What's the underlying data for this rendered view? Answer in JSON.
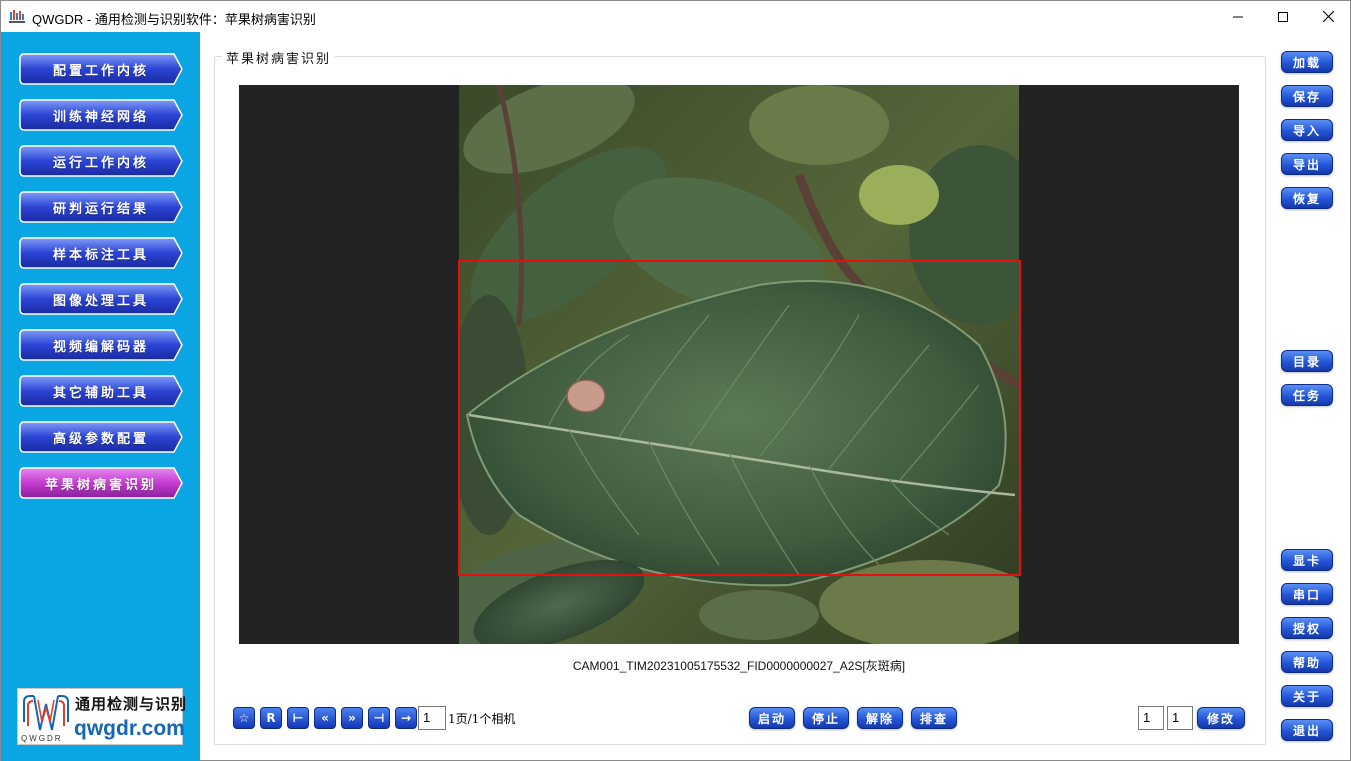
{
  "window": {
    "title": "QWGDR - 通用检测与识别软件：苹果树病害识别",
    "controls": [
      "minimize",
      "maximize",
      "close"
    ]
  },
  "sidebar": {
    "items": [
      {
        "label": "配置工作内核",
        "active": false
      },
      {
        "label": "训练神经网络",
        "active": false
      },
      {
        "label": "运行工作内核",
        "active": false
      },
      {
        "label": "研判运行结果",
        "active": false
      },
      {
        "label": "样本标注工具",
        "active": false
      },
      {
        "label": "图像处理工具",
        "active": false
      },
      {
        "label": "视频编解码器",
        "active": false
      },
      {
        "label": "其它辅助工具",
        "active": false
      },
      {
        "label": "高级参数配置",
        "active": false
      },
      {
        "label": "苹果树病害识别",
        "active": true
      }
    ],
    "logo": {
      "cn_text": "通用检测与识别",
      "en_text": "qwgdr.com",
      "mark_text": "QWGDR"
    }
  },
  "colors": {
    "sidebar_bg": "#0aa5e3",
    "nav_button": "#2c44d6",
    "nav_button_active": "#c63ad0",
    "bbox": "#e21010",
    "button_blue": "#2456d8"
  },
  "main": {
    "group_title": "苹果树病害识别",
    "image_caption": "CAM001_TIM20231005175532_FID0000000027_A2S[灰斑病]",
    "toolbar": {
      "nav_buttons": [
        {
          "name": "star",
          "glyph": "☆"
        },
        {
          "name": "reset",
          "glyph": "R"
        },
        {
          "name": "first",
          "glyph": "⊢"
        },
        {
          "name": "prev",
          "glyph": "«"
        },
        {
          "name": "next",
          "glyph": "»"
        },
        {
          "name": "last",
          "glyph": "⊣"
        },
        {
          "name": "goto",
          "glyph": "→"
        }
      ],
      "page_input": "1",
      "page_info": "1页/1个相机",
      "action_buttons": [
        "启动",
        "停止",
        "解除",
        "排查"
      ],
      "field_a": "1",
      "field_b": "1",
      "modify_label": "修改"
    }
  },
  "right_panel": {
    "top_buttons": [
      "加载",
      "保存",
      "导入",
      "导出",
      "恢复"
    ],
    "middle_buttons": [
      "目录",
      "任务"
    ],
    "bottom_buttons": [
      "显卡",
      "串口",
      "授权",
      "帮助",
      "关于",
      "退出"
    ]
  }
}
